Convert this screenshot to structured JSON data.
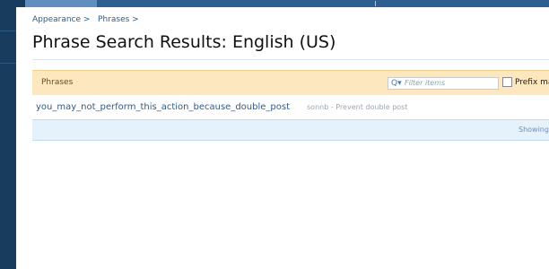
{
  "breadcrumb": [
    "Appearance >",
    "Phrases >"
  ],
  "page": {
    "title": "Phrase Search Results: English (US)"
  },
  "filter": {
    "title": "Phrases",
    "placeholder": "Filter items",
    "prefix_label": "Prefix ma"
  },
  "results": [
    {
      "phrase": "you_may_not_perform_this_action_because_double_post",
      "meta": "sonnb - Prevent double post"
    }
  ],
  "footer": {
    "status": "Showing"
  },
  "colors": {
    "nav_dark": "#183c5d",
    "filter_bar": "#fde7bf",
    "footer_bar": "#e5f1fb",
    "link": "#2d5b8c"
  },
  "icons": {
    "filter": "search-icon"
  }
}
